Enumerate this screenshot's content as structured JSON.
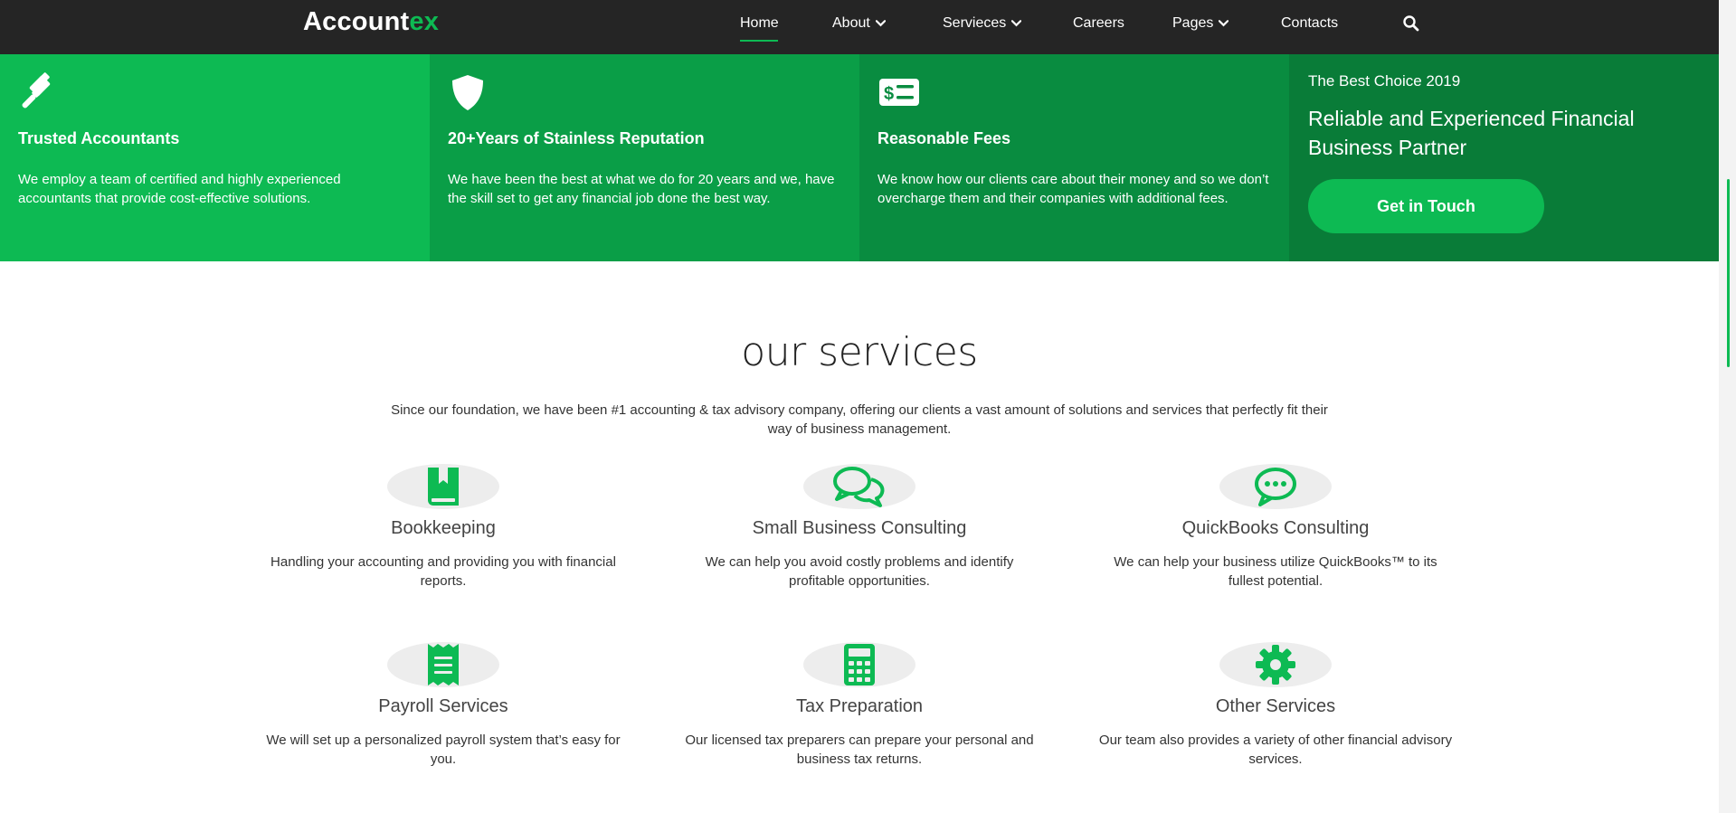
{
  "brand": {
    "name_part1": "Accoun",
    "name_part2": "tex",
    "accent": "ex",
    "accent_color": "#0dba53"
  },
  "nav": {
    "items": [
      {
        "label": "Home",
        "dropdown": false,
        "active": true
      },
      {
        "label": "About",
        "dropdown": true
      },
      {
        "label": "Servieces",
        "dropdown": true
      },
      {
        "label": "Careers",
        "dropdown": false
      },
      {
        "label": "Pages",
        "dropdown": true
      },
      {
        "label": "Contacts",
        "dropdown": false
      }
    ],
    "search_icon": "search-icon"
  },
  "features": [
    {
      "icon": "gavel-icon",
      "title": "Trusted Accountants",
      "text": "We employ a team of certified and highly experienced accountants that provide cost-effective solutions.",
      "bg": "#0dba53"
    },
    {
      "icon": "shield-icon",
      "title": "20+Years of Stainless Reputation",
      "text": "We have been the best at what we do for 20 years and we, have the skill set to get any financial job done the best way.",
      "bg": "#0a9e47"
    },
    {
      "icon": "money-bill-icon",
      "title": "Reasonable Fees",
      "text": "We know how our clients care about their money and so we don’t overcharge them and their companies with additional fees.",
      "bg": "#098c40"
    }
  ],
  "cta": {
    "subtitle": "The Best Choice 2019",
    "title": "Reliable and Experienced Financial Business Partner",
    "button": "Get in Touch",
    "bg": "#097c38"
  },
  "services": {
    "title": "our services",
    "intro": "Since our foundation, we have been #1 accounting & tax advisory company, offering our clients a vast amount of solutions and services that perfectly fit their way of business management.",
    "items": [
      {
        "icon": "book-icon",
        "title": "Bookkeeping",
        "text": "Handling your accounting and providing you with financial reports."
      },
      {
        "icon": "comments-icon",
        "title": "Small Business Consulting",
        "text": "We can help you avoid costly problems and identify profitable opportunities."
      },
      {
        "icon": "comment-dots-icon",
        "title": "QuickBooks Consulting",
        "text": "We can help your business utilize QuickBooks™ to its fullest potential."
      },
      {
        "icon": "receipt-icon",
        "title": "Payroll Services",
        "text": "We will set up a personalized payroll system that’s easy for you."
      },
      {
        "icon": "calculator-icon",
        "title": "Tax Preparation",
        "text": "Our licensed tax preparers can prepare your personal and business tax returns."
      },
      {
        "icon": "gear-icon",
        "title": "Other Services",
        "text": "Our team also provides a variety of other financial advisory services."
      }
    ]
  }
}
